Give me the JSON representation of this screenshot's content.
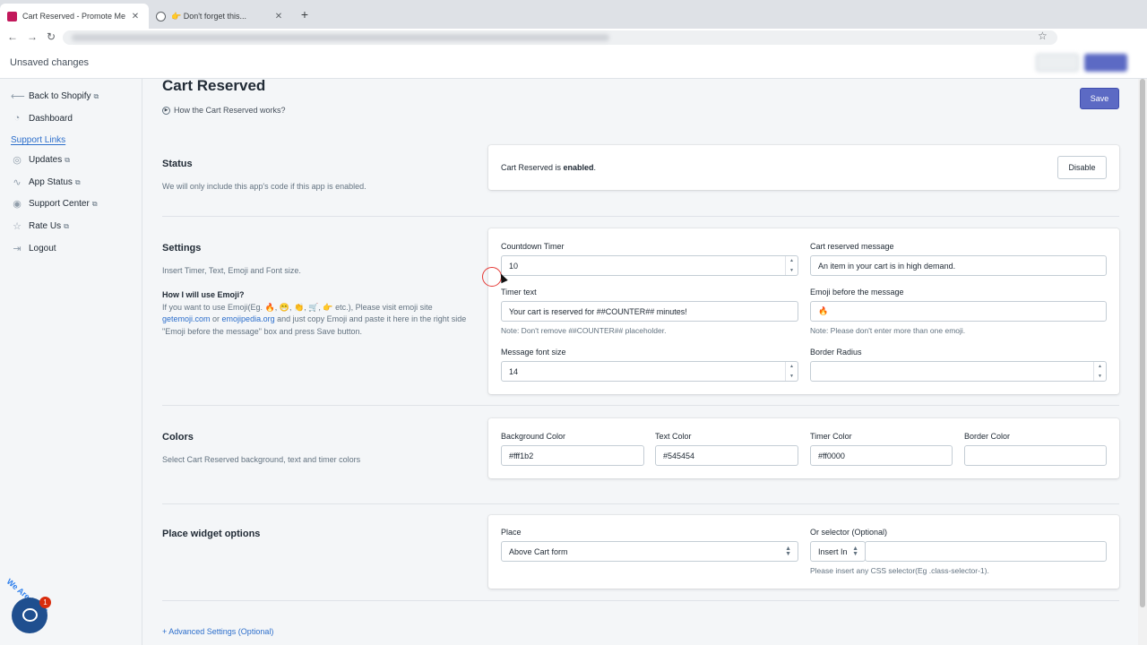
{
  "browser": {
    "tabs": [
      {
        "title": "Cart Reserved - Promote Me",
        "active": true
      },
      {
        "title": "👉 Don't forget this...",
        "active": false
      }
    ],
    "new_tab": "+",
    "back": "←",
    "forward": "→",
    "reload": "↻",
    "star": "☆",
    "close": "✕"
  },
  "context_bar": {
    "message": "Unsaved changes"
  },
  "sidebar": {
    "items": [
      {
        "label": "Back to Shopify",
        "icon": "arrow-left-icon",
        "glyph": "⟵",
        "external": true
      },
      {
        "label": "Dashboard",
        "icon": "dashboard-icon",
        "glyph": "◔",
        "external": false
      }
    ],
    "support_header": "Support Links",
    "support_items": [
      {
        "label": "Updates",
        "icon": "globe-icon",
        "glyph": "◎",
        "external": true
      },
      {
        "label": "App Status",
        "icon": "pulse-icon",
        "glyph": "∿",
        "external": true
      },
      {
        "label": "Support Center",
        "icon": "lifebuoy-icon",
        "glyph": "◉",
        "external": true
      },
      {
        "label": "Rate Us",
        "icon": "star-icon",
        "glyph": "☆",
        "external": true
      },
      {
        "label": "Logout",
        "icon": "logout-icon",
        "glyph": "⇥",
        "external": false
      }
    ],
    "external_glyph": "⧉",
    "chat_badge": "1",
    "chat_tag": "We Are Here!"
  },
  "page": {
    "title": "Cart Reserved",
    "how_link": "How the Cart Reserved works?",
    "save_label": "Save",
    "advanced_link": "+ Advanced Settings (Optional)"
  },
  "status": {
    "title": "Status",
    "desc": "We will only include this app's code if this app is enabled.",
    "prefix": "Cart Reserved is ",
    "state": "enabled",
    "suffix": ".",
    "button": "Disable"
  },
  "settings": {
    "title": "Settings",
    "desc": "Insert Timer, Text, Emoji and Font size.",
    "emoji_heading": "How I will use Emoji?",
    "emoji_text_1": "If you want to use Emoji(Eg. 🔥, 😁, 👏, 🛒, 👉 etc.), Please visit emoji site",
    "emoji_link_1": "getemoji.com",
    "emoji_or": " or ",
    "emoji_link_2": "emojipedia.org",
    "emoji_text_2": " and just copy Emoji and paste it here in the right side \"Emoji before the message\" box and press Save button.",
    "countdown_label": "Countdown Timer",
    "countdown_value": "10",
    "message_label": "Cart reserved message",
    "message_value": "An item in your cart is in high demand.",
    "timer_text_label": "Timer text",
    "timer_text_value": "Your cart is reserved for ##COUNTER## minutes!",
    "timer_text_note": "Note: Don't remove ##COUNTER## placeholder.",
    "emoji_label": "Emoji before the message",
    "emoji_value": "🔥",
    "emoji_note": "Note: Please don't enter more than one emoji.",
    "font_size_label": "Message font size",
    "font_size_value": "14",
    "border_radius_label": "Border Radius",
    "border_radius_value": ""
  },
  "colors": {
    "title": "Colors",
    "desc": "Select Cart Reserved background, text and timer colors",
    "fields": [
      {
        "label": "Background Color",
        "value": "#fff1b2"
      },
      {
        "label": "Text Color",
        "value": "#545454"
      },
      {
        "label": "Timer Color",
        "value": "#ff0000"
      },
      {
        "label": "Border Color",
        "value": ""
      }
    ]
  },
  "place": {
    "title": "Place widget options",
    "place_label": "Place",
    "place_value": "Above Cart form",
    "selector_label": "Or selector (Optional)",
    "insert_value": "Insert In",
    "selector_value": "",
    "selector_note": "Please insert any CSS selector(Eg .class-selector-1)."
  },
  "spinner": {
    "up": "▲",
    "down": "▼"
  },
  "select": {
    "up": "▲",
    "down": "▼"
  },
  "play_glyph": "▶"
}
